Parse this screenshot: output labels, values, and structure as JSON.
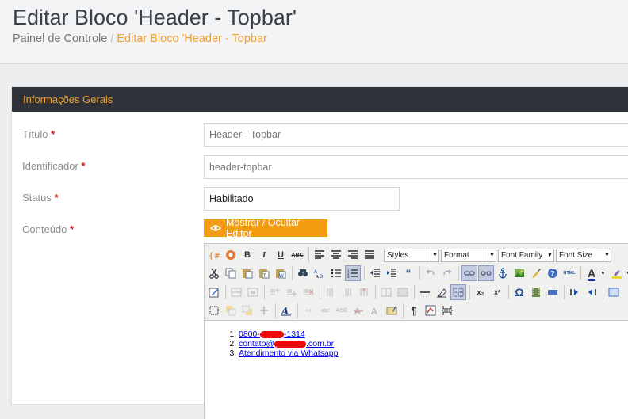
{
  "header": {
    "title": "Editar Bloco 'Header - Topbar'",
    "breadcrumb": {
      "root": "Painel de Controle",
      "separator": "/",
      "current": "Editar Bloco 'Header - Topbar"
    }
  },
  "panel": {
    "heading": "Informações Gerais"
  },
  "form": {
    "required_mark": "*",
    "titulo": {
      "label": "Título",
      "value": "Header - Topbar"
    },
    "identificador": {
      "label": "Identificador",
      "value": "header-topbar"
    },
    "status": {
      "label": "Status",
      "value": "Habilitado"
    },
    "conteudo": {
      "label": "Conteúdo",
      "toggle_button": "Mostrar / Ocultar Editor"
    }
  },
  "editor": {
    "selects": {
      "styles": "Styles",
      "format": "Format",
      "font_family": "Font Family",
      "font_size": "Font Size"
    },
    "glyphs": {
      "bold": "B",
      "italic": "I",
      "underline": "U",
      "strike": "ABC",
      "quote": "“",
      "omega": "Ω",
      "pilcrow": "¶",
      "sub": "x₂",
      "sup": "x²",
      "text_color": "A",
      "html": "HTML"
    },
    "content": {
      "items": [
        {
          "prefix": "0800-",
          "suffix": "-1314"
        },
        {
          "prefix": "contato@",
          "suffix": ".com.br"
        },
        {
          "text": "Atendimento via Whatsapp"
        }
      ]
    }
  },
  "colors": {
    "accent": "#f39c12",
    "panel_heading_bg": "#2f3339",
    "required": "#d02020",
    "link": "#0000ee"
  }
}
